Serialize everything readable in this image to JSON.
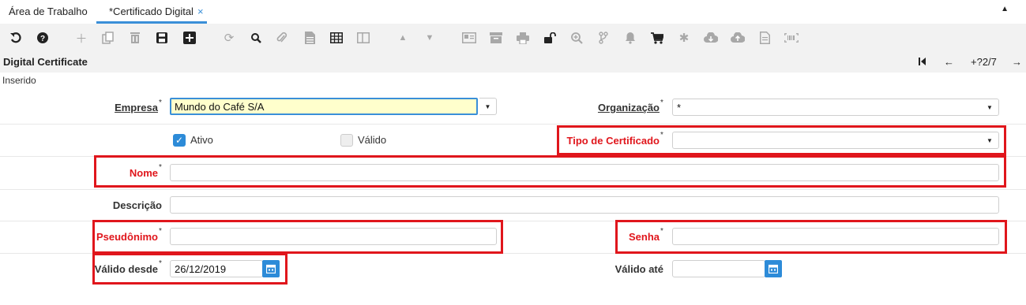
{
  "tabs": [
    {
      "label": "Área de Trabalho"
    },
    {
      "label": "*Certificado Digital",
      "close": "×"
    }
  ],
  "toolbar": {
    "icons": [
      "undo-icon",
      "help-icon",
      "new-icon",
      "copy-icon",
      "delete-icon",
      "save-icon",
      "save-new-icon",
      "refresh-icon",
      "find-icon",
      "attachment-icon",
      "report-icon",
      "grid-icon",
      "split-view-icon",
      "previous-record-icon",
      "next-record-icon",
      "archive-viewer-icon",
      "archive-icon",
      "print-icon",
      "lock-icon",
      "zoom-icon",
      "workflow-icon",
      "notification-icon",
      "cart-icon",
      "settings-icon",
      "download-icon",
      "upload-icon",
      "document-icon",
      "barcode-icon"
    ]
  },
  "header": {
    "title": "Digital Certificate",
    "record_nav": "+?2/7",
    "status": "Inserido"
  },
  "form": {
    "empresa": {
      "label": "Empresa",
      "star": "*",
      "value": "Mundo do Café S/A"
    },
    "organizacao": {
      "label": "Organização",
      "star": "*",
      "value": "*"
    },
    "ativo": {
      "label": "Ativo",
      "checked": true
    },
    "valido": {
      "label": "Válido",
      "checked": false
    },
    "tipo_certificado": {
      "label": "Tipo de Certificado",
      "star": "*",
      "value": ""
    },
    "nome": {
      "label": "Nome",
      "star": "*",
      "value": ""
    },
    "descricao": {
      "label": "Descrição",
      "value": ""
    },
    "pseudonimo": {
      "label": "Pseudônimo",
      "star": "*",
      "value": ""
    },
    "senha": {
      "label": "Senha",
      "star": "*",
      "value": ""
    },
    "valido_desde": {
      "label": "Válido desde",
      "star": "*",
      "value": "26/12/2019"
    },
    "valido_ate": {
      "label": "Válido até",
      "value": ""
    }
  },
  "colors": {
    "accent": "#2d8bd8",
    "required": "#e0161c",
    "focus_bg": "#ffffcc"
  }
}
